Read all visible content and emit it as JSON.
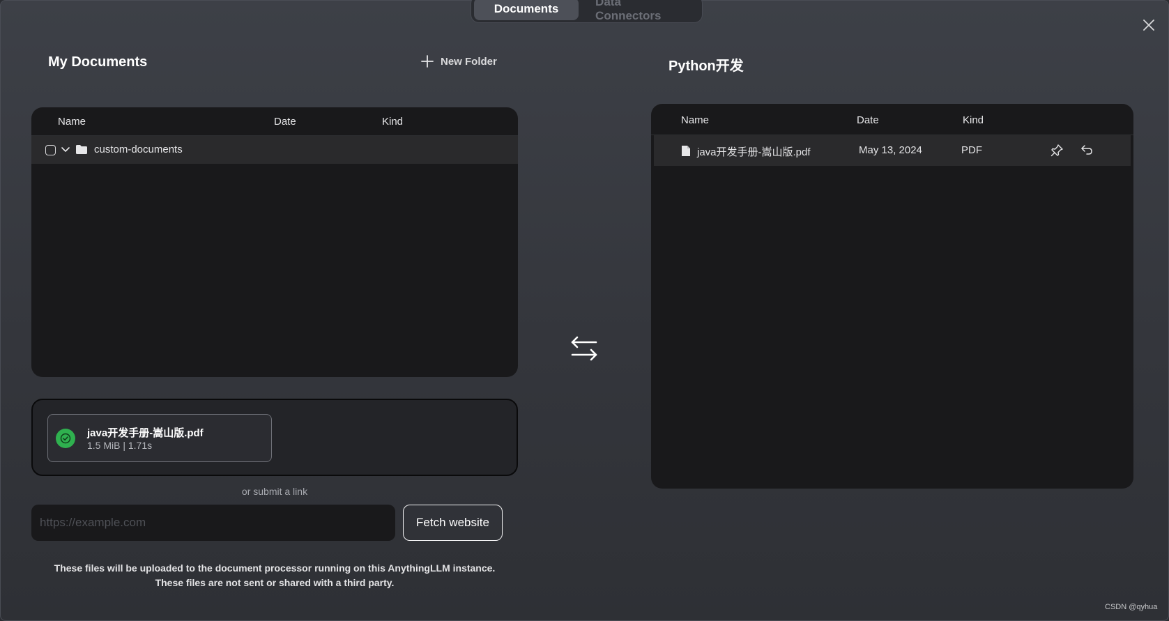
{
  "tabs": [
    {
      "label": "Documents",
      "active": true
    },
    {
      "label": "Data Connectors",
      "active": false
    }
  ],
  "left": {
    "title": "My Documents",
    "new_folder_label": "New Folder",
    "columns": {
      "name": "Name",
      "date": "Date",
      "kind": "Kind"
    },
    "folders": [
      {
        "name": "custom-documents",
        "expanded": true,
        "checked": false
      }
    ]
  },
  "upload": {
    "file": {
      "name": "java开发手册-嵩山版.pdf",
      "meta": "1.5 MiB | 1.71s",
      "status": "success"
    },
    "or_link": "or submit a link",
    "url_placeholder": "https://example.com",
    "url_value": "",
    "fetch_label": "Fetch website",
    "disclaimer_line1": "These files will be uploaded to the document processor running on this AnythingLLM instance.",
    "disclaimer_line2": "These files are not sent or shared with a third party."
  },
  "right": {
    "title": "Python开发",
    "columns": {
      "name": "Name",
      "date": "Date",
      "kind": "Kind"
    },
    "files": [
      {
        "name": "java开发手册-嵩山版.pdf",
        "date": "May 13, 2024",
        "kind": "PDF"
      }
    ]
  },
  "watermark": "CSDN @qyhua",
  "colors": {
    "success": "#2fb14f",
    "panel_bg": "#19191b",
    "modal_bg": "#3a3d44"
  },
  "icons": [
    "close-icon",
    "plus-icon",
    "chevron-down-icon",
    "folder-icon",
    "check-circle-icon",
    "swap-arrows-icon",
    "file-icon",
    "pin-icon",
    "undo-icon"
  ]
}
